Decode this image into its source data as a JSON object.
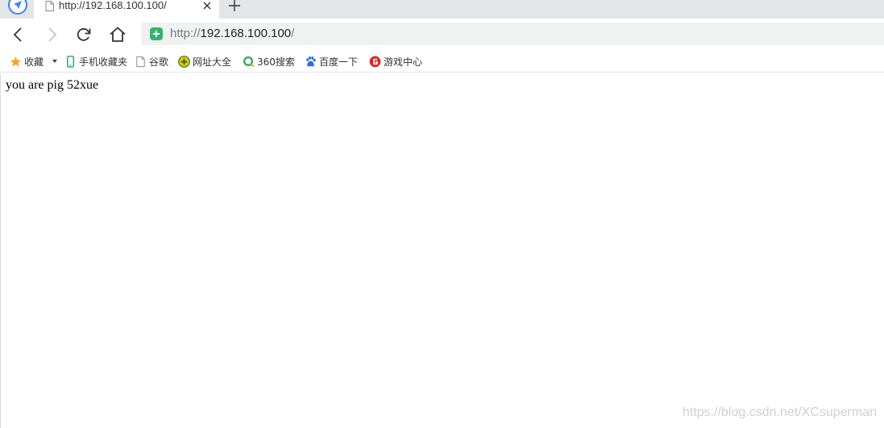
{
  "tab": {
    "title": "http://192.168.100.100/"
  },
  "address_bar": {
    "scheme": "http://",
    "host": "192.168.100.100",
    "path": "/"
  },
  "bookmarks": [
    {
      "label": "收藏",
      "icon": "star-icon"
    },
    {
      "label": "手机收藏夹",
      "icon": "phone-icon"
    },
    {
      "label": "谷歌",
      "icon": "page-icon"
    },
    {
      "label": "网址大全",
      "icon": "hao-icon"
    },
    {
      "label": "360搜索",
      "icon": "360-search-icon"
    },
    {
      "label": "百度一下",
      "icon": "baidu-paw-icon"
    },
    {
      "label": "游戏中心",
      "icon": "game-center-icon"
    }
  ],
  "page": {
    "text": "you are pig 52xue"
  },
  "watermark": "https://blog.csdn.net/XCsuperman",
  "colors": {
    "tabstrip": "#e3e5e8",
    "address_bar": "#eff1f3",
    "secure_green": "#34b46a",
    "star_orange": "#f5a623",
    "game_red": "#d9252a"
  }
}
